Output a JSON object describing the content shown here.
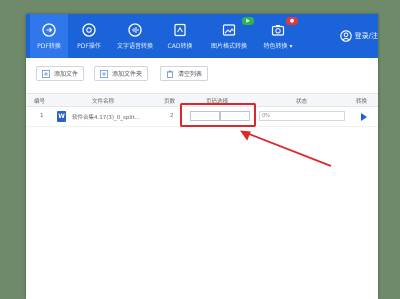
{
  "toolbar": {
    "tools": [
      {
        "label": "PDF转换",
        "icon": "pdf-convert-icon"
      },
      {
        "label": "PDF操作",
        "icon": "pdf-operate-icon"
      },
      {
        "label": "文字语音转换",
        "icon": "voice-icon"
      },
      {
        "label": "CAD转换",
        "icon": "cad-icon"
      },
      {
        "label": "图片格式转换",
        "icon": "image-icon",
        "badge": "▶"
      },
      {
        "label": "特色转换 ▾",
        "icon": "camera-icon",
        "badge": "●"
      }
    ],
    "login_label": "登录/注"
  },
  "actions": {
    "add_file": "添加文件",
    "add_folder": "添加文件夹",
    "clear_list": "清空列表"
  },
  "table": {
    "headers": [
      "编号",
      "文件名称",
      "页数",
      "页码选择",
      "状态",
      "转换"
    ],
    "rows": [
      {
        "index": "1",
        "icon": "W",
        "name": "软件合集4.17(3)_0_split...",
        "pages": "2",
        "progress": "0%"
      }
    ]
  },
  "colors": {
    "accent": "#1b63d8",
    "highlight": "#d9292f",
    "background": "#6f8a6a"
  }
}
